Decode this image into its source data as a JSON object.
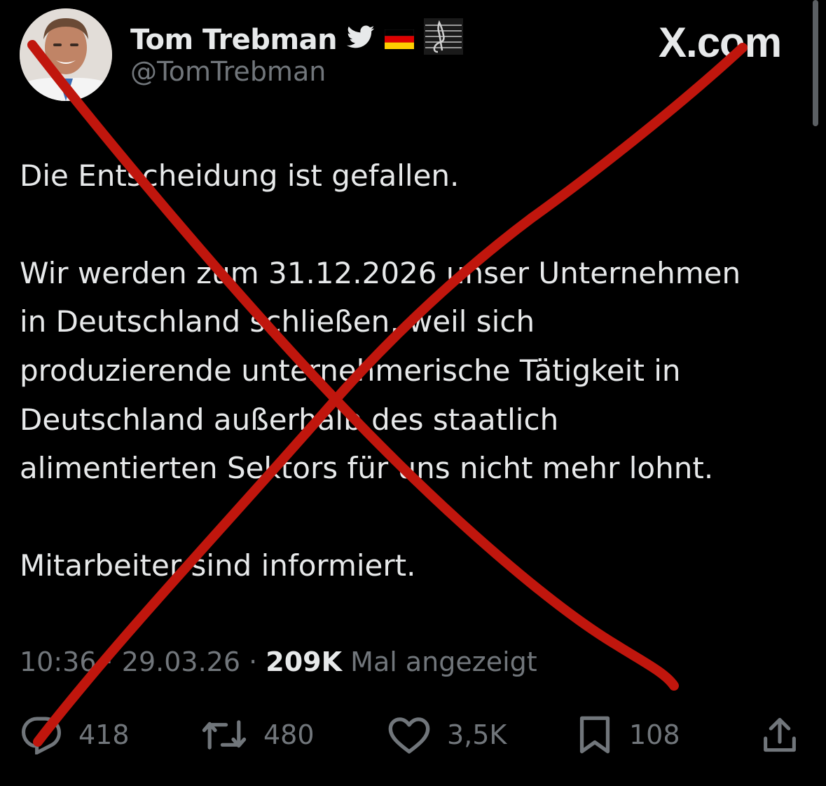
{
  "author": {
    "name": "Tom Trebman",
    "handle": "@TomTrebman",
    "badges": [
      "bird-icon",
      "germany-flag-icon",
      "music-staff-icon"
    ]
  },
  "brand": "X.com",
  "tweet": {
    "lines": [
      "Die Entscheidung ist gefallen.",
      "Wir werden zum 31.12.2026 unser Unternehmen",
      "in Deutschland schließen, weil sich",
      "produzierende unternehmerische Tätigkeit in",
      "Deutschland außerhalb des staatlich",
      "alimentierten Sektors für uns nicht mehr lohnt.",
      "Mitarbeiter sind informiert."
    ]
  },
  "meta": {
    "time": "10:36",
    "date": "29.03.26",
    "separator": "·",
    "views": "209K",
    "views_label": "Mal angezeigt"
  },
  "actions": {
    "replies": "418",
    "reposts": "480",
    "likes": "3,5K",
    "bookmarks": "108"
  },
  "colors": {
    "background": "#000000",
    "text": "#e7e9ea",
    "muted": "#71767b",
    "cross": "#c0160d"
  }
}
